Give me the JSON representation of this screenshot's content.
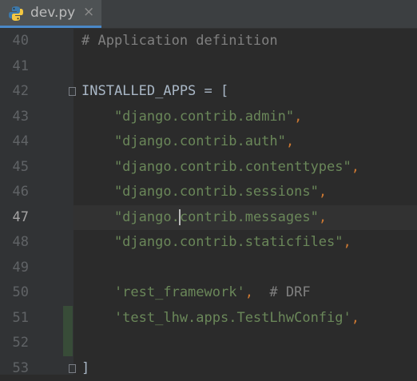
{
  "tab": {
    "label": "dev.py",
    "close": "×",
    "icon": "python-file-icon"
  },
  "editor": {
    "current_line": 47,
    "lines": [
      {
        "num": "40",
        "parts": [
          [
            "c-comment",
            "# Application definition"
          ]
        ]
      },
      {
        "num": "41",
        "parts": []
      },
      {
        "num": "42",
        "parts": [
          [
            "c-op",
            "INSTALLED_APPS = ["
          ]
        ]
      },
      {
        "num": "43",
        "parts": [
          [
            "c-str",
            "    \"django.contrib.admin\""
          ],
          [
            "c-punc",
            ","
          ]
        ]
      },
      {
        "num": "44",
        "parts": [
          [
            "c-str",
            "    \"django.contrib.auth\""
          ],
          [
            "c-punc",
            ","
          ]
        ]
      },
      {
        "num": "45",
        "parts": [
          [
            "c-str",
            "    \"django.contrib.contenttypes\""
          ],
          [
            "c-punc",
            ","
          ]
        ]
      },
      {
        "num": "46",
        "parts": [
          [
            "c-str",
            "    \"django.contrib.sessions\""
          ],
          [
            "c-punc",
            ","
          ]
        ]
      },
      {
        "num": "47",
        "parts": [
          [
            "c-str",
            "    \"django."
          ],
          [
            "caret",
            ""
          ],
          [
            "c-str",
            "contrib.messages\""
          ],
          [
            "c-punc",
            ","
          ]
        ]
      },
      {
        "num": "48",
        "parts": [
          [
            "c-str",
            "    \"django.contrib.staticfiles\""
          ],
          [
            "c-punc",
            ","
          ]
        ]
      },
      {
        "num": "49",
        "parts": []
      },
      {
        "num": "50",
        "parts": [
          [
            "c-str",
            "    'rest_framework'"
          ],
          [
            "c-punc",
            ","
          ],
          [
            "c-comment",
            "  # DRF"
          ]
        ]
      },
      {
        "num": "51",
        "parts": [
          [
            "c-str",
            "    'test_lhw.apps.TestLhwConfig'"
          ],
          [
            "c-punc",
            ","
          ]
        ]
      },
      {
        "num": "52",
        "parts": []
      },
      {
        "num": "53",
        "parts": [
          [
            "c-op",
            "]"
          ]
        ]
      }
    ]
  },
  "colors": {
    "background": "#2b2b2b",
    "string": "#6a8759",
    "comment": "#808080",
    "keyword_punctuation": "#cc7832",
    "identifier": "#a9b7c6",
    "change_marker": "#384c38"
  }
}
